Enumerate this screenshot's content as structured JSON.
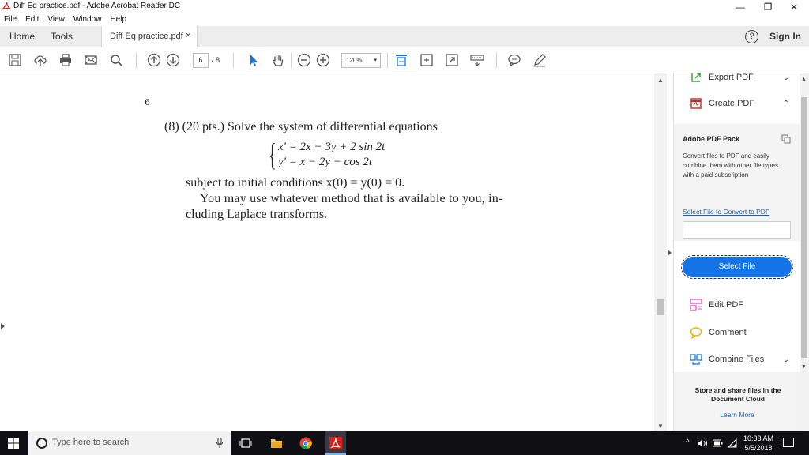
{
  "window": {
    "title": "Diff Eq practice.pdf - Adobe Acrobat Reader DC",
    "minimize": "—",
    "restore": "❐",
    "close": "✕"
  },
  "menu": [
    "File",
    "Edit",
    "View",
    "Window",
    "Help"
  ],
  "tabs": {
    "home": "Home",
    "tools": "Tools",
    "document": "Diff Eq practice.pdf",
    "document_close": "×",
    "help": "?",
    "sign_in": "Sign In"
  },
  "toolbar": {
    "current_page": "6",
    "page_total": "/ 8",
    "zoom": "120%",
    "zoom_caret": "▾",
    "icons": [
      "save-icon",
      "upload-icon",
      "print-icon",
      "email-icon",
      "search-icon",
      "prev-page-icon",
      "next-page-icon",
      "select-cursor-icon",
      "hand-icon",
      "zoom-out-icon",
      "zoom-in-icon",
      "fit-width-icon",
      "rotate-icon",
      "full-screen-icon",
      "keyboard-icon",
      "comment-icon",
      "pen-icon"
    ]
  },
  "document": {
    "page_number": "6",
    "problem": "(8) (20 pts.) Solve the system of differential equations",
    "brace": "{",
    "eq1": "x′ = 2x − 3y + 2 sin 2t",
    "eq2": "y′ = x − 2y − cos 2t",
    "conditions": "subject to initial conditions x(0) = y(0) = 0.",
    "line2": "You may use whatever method that is available to you, in-",
    "line3": "cluding Laplace transforms."
  },
  "scroll": {
    "up": "▲",
    "down": "▼"
  },
  "pane": {
    "export_pdf": "Export PDF",
    "create_pdf": "Create PDF",
    "chevron_down": "⌄",
    "chevron_up": "⌃",
    "pack_heading": "Adobe PDF Pack",
    "pack_desc": "Convert files to PDF and easily combine them with other file types with a paid subscription",
    "select_link": "Select File to Convert to PDF",
    "select_button": "Select File",
    "edit_pdf": "Edit PDF",
    "comment": "Comment",
    "combine_files": "Combine Files",
    "store_text": "Store and share files in the Document Cloud",
    "learn_more": "Learn More"
  },
  "taskbar": {
    "search_placeholder": "Type here to search",
    "time": "10:33 AM",
    "date": "5/5/2018",
    "tray_caret": "^"
  },
  "colors": {
    "accent_blue": "#1473e6",
    "link_blue": "#1a5fb4",
    "acrobat_red": "#d4211c",
    "taskbar": "#0f0f14"
  }
}
